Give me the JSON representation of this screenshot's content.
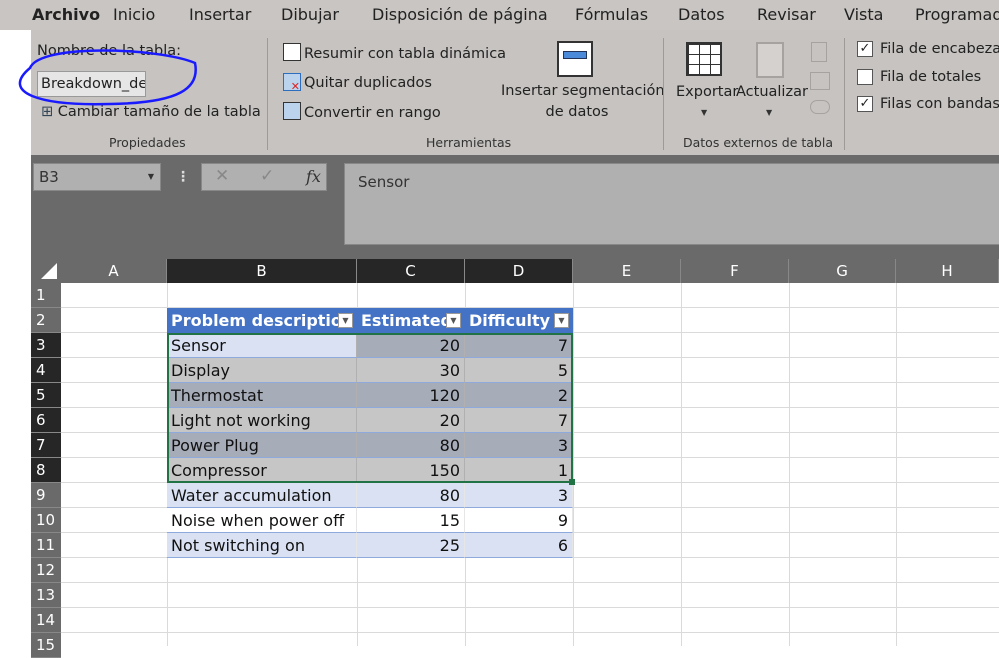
{
  "tabs": [
    "Archivo",
    "Inicio",
    "Insertar",
    "Dibujar",
    "Disposición de página",
    "Fórmulas",
    "Datos",
    "Revisar",
    "Vista",
    "Programad"
  ],
  "ribbon": {
    "table_name_label": "Nombre de la tabla:",
    "table_name_value": "Breakdown_des",
    "resize_table": "Cambiar tamaño de la tabla",
    "group_properties": "Propiedades",
    "pivot": "Resumir con tabla dinámica",
    "remove_duplicates": "Quitar duplicados",
    "convert_range": "Convertir en rango",
    "slicer_line1": "Insertar segmentación",
    "slicer_line2": "de datos",
    "group_tools": "Herramientas",
    "export": "Exportar",
    "refresh": "Actualizar",
    "group_external": "Datos externos de tabla",
    "options": [
      {
        "label": "Fila de encabezado",
        "checked": true
      },
      {
        "label": "Fila de totales",
        "checked": false
      },
      {
        "label": "Filas con bandas",
        "checked": true
      }
    ]
  },
  "formula_bar": {
    "name_box": "B3",
    "cancel": "✕",
    "enter": "✓",
    "fx": "fx",
    "content": "Sensor"
  },
  "sheet": {
    "columns": [
      "A",
      "B",
      "C",
      "D",
      "E",
      "F",
      "G",
      "H"
    ],
    "rows": [
      "1",
      "2",
      "3",
      "4",
      "5",
      "6",
      "7",
      "8",
      "9",
      "10",
      "11",
      "12",
      "13",
      "14",
      "15"
    ],
    "headers": [
      "Problem description",
      "Estimated",
      "Difficulty"
    ],
    "data": [
      [
        "Sensor",
        "20",
        "7"
      ],
      [
        "Display",
        "30",
        "5"
      ],
      [
        "Thermostat",
        "120",
        "2"
      ],
      [
        "Light not working",
        "20",
        "7"
      ],
      [
        "Power Plug",
        "80",
        "3"
      ],
      [
        "Compressor",
        "150",
        "1"
      ],
      [
        "Water accumulation",
        "80",
        "3"
      ],
      [
        "Noise when power off",
        "15",
        "9"
      ],
      [
        "Not switching on",
        "25",
        "6"
      ]
    ],
    "header_color": "#4472c4",
    "band_color": "#d9e1f2",
    "selection_color": "#217346"
  }
}
